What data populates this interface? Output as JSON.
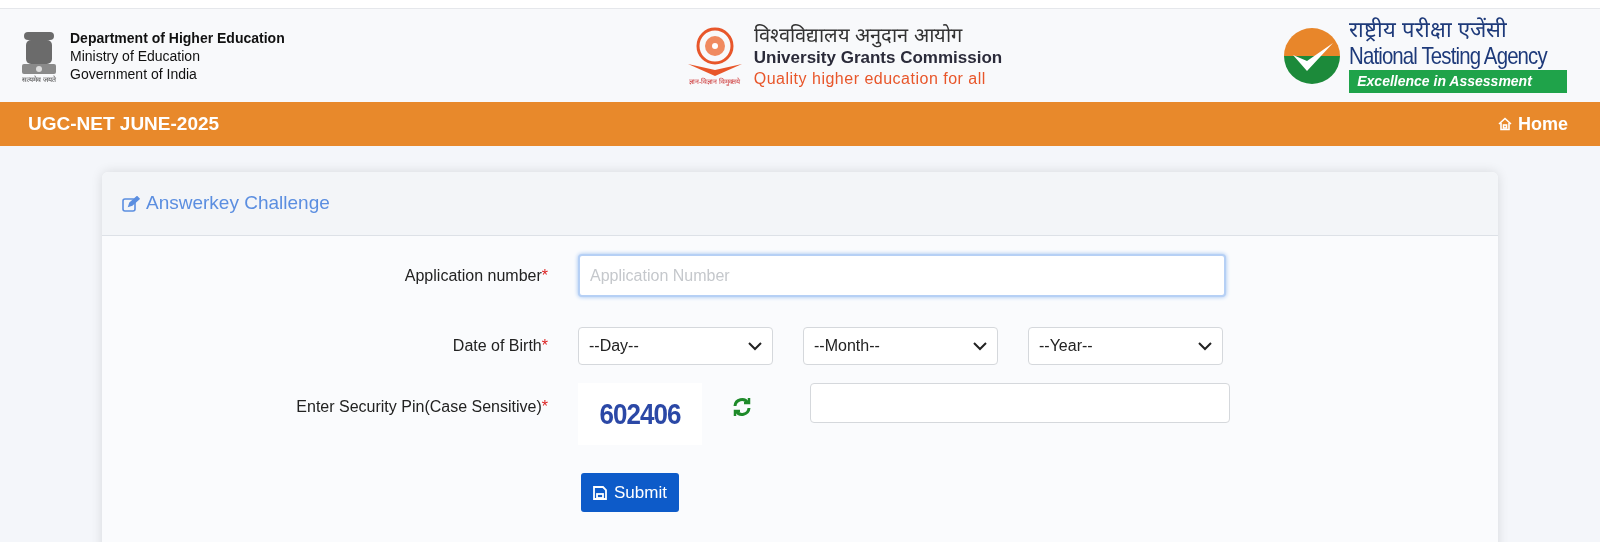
{
  "header": {
    "left": {
      "emblem_caption": "सत्यमेव जयते",
      "lines": [
        "Department of Higher Education",
        "Ministry of Education",
        "Government of India"
      ]
    },
    "center": {
      "logo_caption": "ज्ञान-विज्ञान विमुक्तये",
      "hindi": "विश्वविद्यालय अनुदान आयोग",
      "name": "University Grants Commission",
      "tagline": "Quality higher education for all"
    },
    "right": {
      "hindi": "राष्ट्रीय परीक्षा एजेंसी",
      "name": "National Testing Agency",
      "tagline": "Excellence in Assessment"
    }
  },
  "navbar": {
    "title": "UGC-NET JUNE-2025",
    "home": "Home"
  },
  "card": {
    "title": "Answerkey Challenge",
    "fields": [
      {
        "kind": "text",
        "label": "Application number",
        "required_mark": "*",
        "placeholder": "Application Number",
        "focused": true
      },
      {
        "kind": "selects",
        "label": "Date of Birth",
        "required_mark": "*",
        "options": [
          "--Day--",
          "--Month--",
          "--Year--"
        ]
      },
      {
        "kind": "captcha",
        "label": "Enter Security Pin(Case Sensitive)",
        "required_mark": "*",
        "captcha": "602406"
      }
    ],
    "submit": "Submit"
  }
}
